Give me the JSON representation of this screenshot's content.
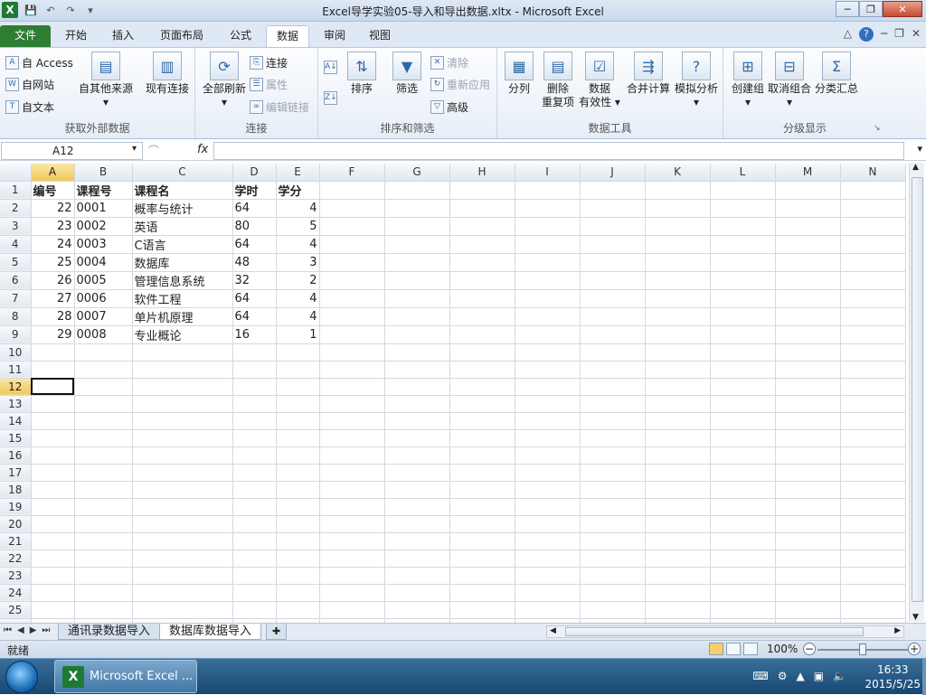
{
  "window": {
    "title": "Excel导学实验05-导入和导出数据.xltx  -  Microsoft Excel"
  },
  "tabs": [
    "文件",
    "开始",
    "插入",
    "页面布局",
    "公式",
    "数据",
    "审阅",
    "视图"
  ],
  "active_tab": "数据",
  "ribbon": {
    "get_external": {
      "access": "自 Access",
      "web": "自网站",
      "text": "自文本",
      "other": "自其他来源",
      "existing": "现有连接",
      "label": "获取外部数据"
    },
    "connections": {
      "refresh_all": "全部刷新",
      "connections": "连接",
      "properties": "属性",
      "edit_links": "编辑链接",
      "label": "连接"
    },
    "sort_filter": {
      "sort": "排序",
      "filter": "筛选",
      "clear": "清除",
      "reapply": "重新应用",
      "advanced": "高级",
      "label": "排序和筛选"
    },
    "data_tools": {
      "text_to_columns": "分列",
      "remove_dup_1": "删除",
      "remove_dup_2": "重复项",
      "validation_1": "数据",
      "validation_2": "有效性",
      "consolidate": "合并计算",
      "what_if": "模拟分析",
      "label": "数据工具"
    },
    "outline": {
      "group": "创建组",
      "ungroup": "取消组合",
      "subtotal": "分类汇总",
      "label": "分级显示"
    }
  },
  "formula_bar": {
    "name_box": "A12",
    "fx": "fx",
    "formula": ""
  },
  "columns": [
    "A",
    "B",
    "C",
    "D",
    "E",
    "F",
    "G",
    "H",
    "I",
    "J",
    "K",
    "L",
    "M",
    "N"
  ],
  "selected_column": "A",
  "selected_row": 12,
  "header_row": [
    "编号",
    "课程号",
    "课程名",
    "学时",
    "学分"
  ],
  "rows": [
    [
      "22",
      "0001",
      "概率与统计",
      "64",
      "4"
    ],
    [
      "23",
      "0002",
      "英语",
      "80",
      "5"
    ],
    [
      "24",
      "0003",
      "C语言",
      "64",
      "4"
    ],
    [
      "25",
      "0004",
      "数据库",
      "48",
      "3"
    ],
    [
      "26",
      "0005",
      "管理信息系统",
      "32",
      "2"
    ],
    [
      "27",
      "0006",
      "软件工程",
      "64",
      "4"
    ],
    [
      "28",
      "0007",
      "单片机原理",
      "64",
      "4"
    ],
    [
      "29",
      "0008",
      "专业概论",
      "16",
      "1"
    ]
  ],
  "row_numbers": [
    "1",
    "2",
    "3",
    "4",
    "5",
    "6",
    "7",
    "8",
    "9",
    "10",
    "11",
    "12",
    "13",
    "14",
    "15",
    "16",
    "17",
    "18",
    "19",
    "20",
    "21",
    "22",
    "23",
    "24",
    "25",
    "26"
  ],
  "sheets": [
    "通讯录数据导入",
    "数据库数据导入"
  ],
  "active_sheet": "数据库数据导入",
  "status": {
    "ready": "就绪",
    "zoom": "100%"
  },
  "taskbar": {
    "app": "Microsoft Excel ...",
    "time": "16:33",
    "date": "2015/5/25"
  }
}
